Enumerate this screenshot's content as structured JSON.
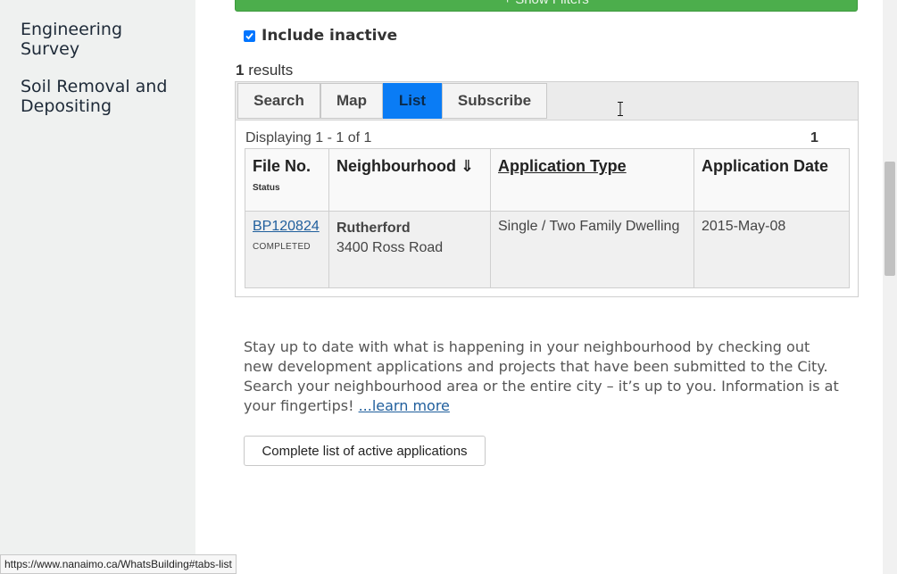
{
  "sidebar": {
    "items": [
      {
        "label_line1": "Engineering",
        "label_line2": "Survey"
      },
      {
        "label_line1": "Soil Removal and",
        "label_line2": "Depositing"
      }
    ]
  },
  "filters": {
    "show_filters_label": "+ Show Filters",
    "include_inactive_label": "Include inactive",
    "include_inactive_checked": true
  },
  "results": {
    "count": "1",
    "label": "results"
  },
  "tabs": [
    {
      "label": "Search",
      "active": false
    },
    {
      "label": "Map",
      "active": false
    },
    {
      "label": "List",
      "active": true
    },
    {
      "label": "Subscribe",
      "active": false
    }
  ],
  "list": {
    "displaying": "Displaying 1 - 1 of 1",
    "page": "1",
    "columns": {
      "file_no": "File No.",
      "status": "Status",
      "neighbourhood": "Neighbourhood ⇓",
      "application_type": "Application Type",
      "application_date": "Application Date"
    },
    "rows": [
      {
        "file_no": "BP120824",
        "status": "COMPLETED",
        "neighbourhood": "Rutherford",
        "address": "3400 Ross Road",
        "application_type": "Single / Two Family Dwelling",
        "application_date": "2015-May-08"
      }
    ]
  },
  "info": {
    "text": "Stay up to date with what is happening in your neighbourhood by checking out new development applications and projects that have been submitted to the City. Search your neighbourhood area or the entire city – it’s up to you. Information is at your fingertips! ",
    "learn_more": "...learn more"
  },
  "active_button_label": "Complete list of active applications",
  "status_bar_url": "https://www.nanaimo.ca/WhatsBuilding#tabs-list",
  "colors": {
    "sidebar_bg": "#eff1f0",
    "accent_green": "#4cae4c",
    "tab_active": "#0a7cf5",
    "link": "#1f5e9c"
  }
}
